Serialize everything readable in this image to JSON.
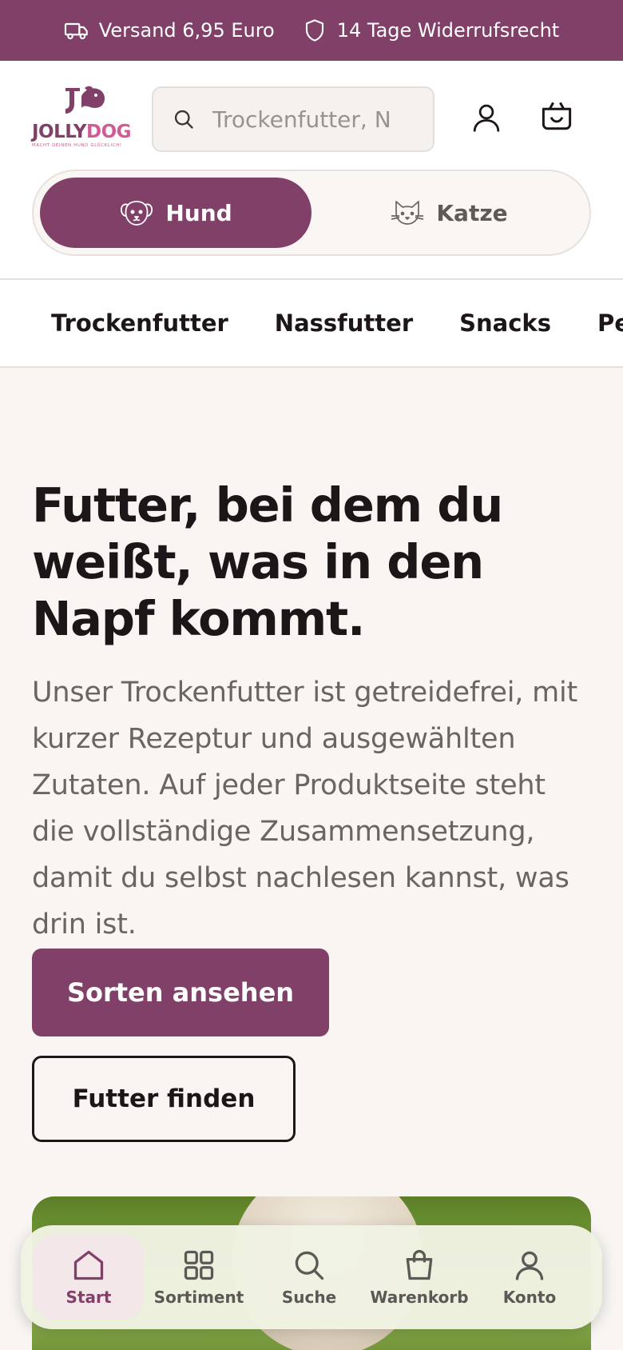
{
  "topbar": {
    "shipping": "Versand 6,95 Euro",
    "returns": "14 Tage Widerrufsrecht"
  },
  "header": {
    "logo_jolly": "JOLLY",
    "logo_dog": "DOG",
    "logo_tagline": "MACHT DEINEN HUND GLÜCKLICH!",
    "search_placeholder": "Trockenfutter, N"
  },
  "toggle": {
    "dog": "Hund",
    "cat": "Katze"
  },
  "categories": [
    "Trockenfutter",
    "Nassfutter",
    "Snacks",
    "Peptide"
  ],
  "hero": {
    "title": "Futter, bei dem du weißt, was in den Napf kommt.",
    "text": "Unser Trockenfutter ist getreidefrei, mit kurzer Rezeptur und ausgewählten Zutaten. Auf jeder Produktseite steht die vollständige Zusammensetzung, damit du selbst nachlesen kannst, was drin ist.",
    "primary": "Sorten ansehen",
    "secondary": "Futter finden"
  },
  "bottom_nav": [
    {
      "label": "Start",
      "icon": "home-icon",
      "active": true
    },
    {
      "label": "Sortiment",
      "icon": "grid-icon",
      "active": false
    },
    {
      "label": "Suche",
      "icon": "search-icon",
      "active": false
    },
    {
      "label": "Warenkorb",
      "icon": "bag-icon",
      "active": false
    },
    {
      "label": "Konto",
      "icon": "user-icon",
      "active": false
    }
  ],
  "colors": {
    "brand": "#814068",
    "accent_pink": "#d25b93",
    "background": "#f8f5f3"
  }
}
